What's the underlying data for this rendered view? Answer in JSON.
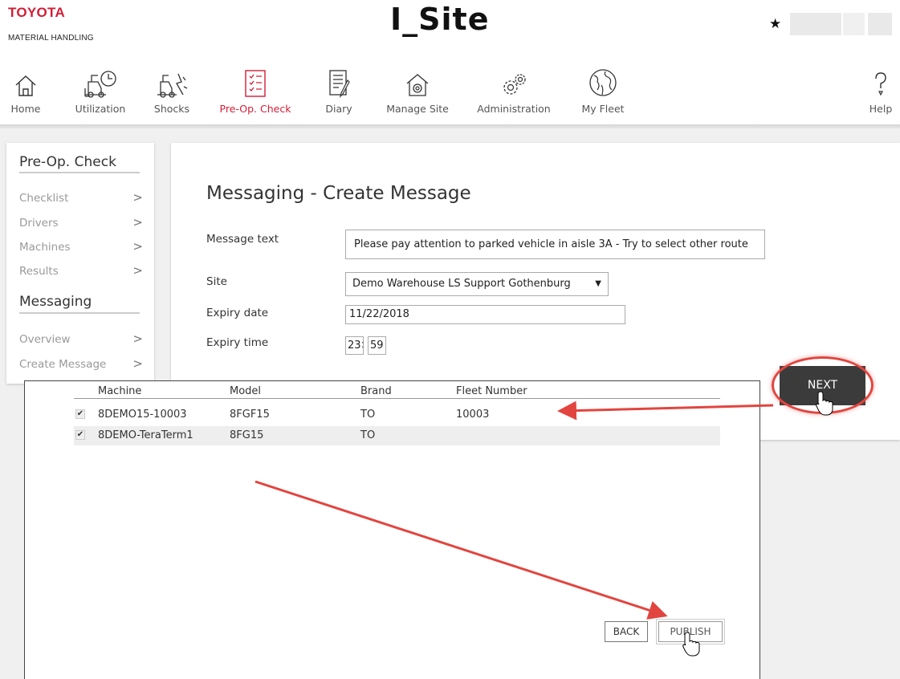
{
  "header": {
    "brand_name": "TOYOTA",
    "brand_sub": "MATERIAL HANDLING",
    "app_title": "I_Site",
    "favorite_icon": "star-icon"
  },
  "nav": {
    "items": [
      {
        "label": "Home",
        "icon": "home-icon"
      },
      {
        "label": "Utilization",
        "icon": "utilization-icon"
      },
      {
        "label": "Shocks",
        "icon": "shocks-icon"
      },
      {
        "label": "Pre-Op. Check",
        "icon": "checklist-icon",
        "active": true
      },
      {
        "label": "Diary",
        "icon": "diary-icon"
      },
      {
        "label": "Manage Site",
        "icon": "manage-site-icon"
      },
      {
        "label": "Administration",
        "icon": "administration-icon"
      },
      {
        "label": "My Fleet",
        "icon": "globe-icon"
      },
      {
        "label": "Help",
        "icon": "help-icon"
      }
    ]
  },
  "sidebar": {
    "section1_title": "Pre-Op. Check",
    "section1_items": [
      "Checklist",
      "Drivers",
      "Machines",
      "Results"
    ],
    "section2_title": "Messaging",
    "section2_items": [
      "Overview",
      "Create Message"
    ]
  },
  "form": {
    "title": "Messaging - Create Message",
    "message_label": "Message text",
    "message_value": "Please pay attention to parked vehicle in aisle 3A - Try to select other route",
    "site_label": "Site",
    "site_value": "Demo Warehouse LS Support Gothenburg",
    "expiry_date_label": "Expiry date",
    "expiry_date_value": "11/22/2018",
    "expiry_time_label": "Expiry time",
    "expiry_hour": "23",
    "expiry_minute": "59",
    "next_label": "NEXT"
  },
  "machines": {
    "columns": [
      "Machine",
      "Model",
      "Brand",
      "Fleet Number"
    ],
    "rows": [
      {
        "checked": true,
        "machine": "8DEMO15-10003",
        "model": "8FGF15",
        "brand": "TO",
        "fleet": "10003"
      },
      {
        "checked": true,
        "machine": "8DEMO-TeraTerm1",
        "model": "8FG15",
        "brand": "TO",
        "fleet": ""
      }
    ],
    "back_label": "BACK",
    "publish_label": "PUBLISH"
  },
  "colors": {
    "brand_red": "#d31d35",
    "annotation_red": "#e2453f",
    "next_button": "#3b3b3b"
  }
}
